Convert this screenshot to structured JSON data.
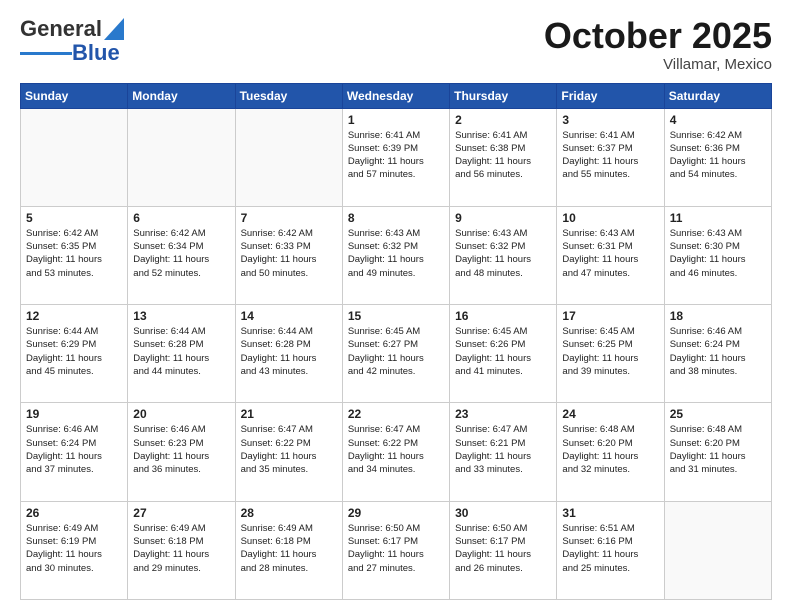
{
  "header": {
    "logo_general": "General",
    "logo_blue": "Blue",
    "month_title": "October 2025",
    "subtitle": "Villamar, Mexico"
  },
  "weekdays": [
    "Sunday",
    "Monday",
    "Tuesday",
    "Wednesday",
    "Thursday",
    "Friday",
    "Saturday"
  ],
  "weeks": [
    [
      {
        "day": "",
        "info": ""
      },
      {
        "day": "",
        "info": ""
      },
      {
        "day": "",
        "info": ""
      },
      {
        "day": "1",
        "info": "Sunrise: 6:41 AM\nSunset: 6:39 PM\nDaylight: 11 hours\nand 57 minutes."
      },
      {
        "day": "2",
        "info": "Sunrise: 6:41 AM\nSunset: 6:38 PM\nDaylight: 11 hours\nand 56 minutes."
      },
      {
        "day": "3",
        "info": "Sunrise: 6:41 AM\nSunset: 6:37 PM\nDaylight: 11 hours\nand 55 minutes."
      },
      {
        "day": "4",
        "info": "Sunrise: 6:42 AM\nSunset: 6:36 PM\nDaylight: 11 hours\nand 54 minutes."
      }
    ],
    [
      {
        "day": "5",
        "info": "Sunrise: 6:42 AM\nSunset: 6:35 PM\nDaylight: 11 hours\nand 53 minutes."
      },
      {
        "day": "6",
        "info": "Sunrise: 6:42 AM\nSunset: 6:34 PM\nDaylight: 11 hours\nand 52 minutes."
      },
      {
        "day": "7",
        "info": "Sunrise: 6:42 AM\nSunset: 6:33 PM\nDaylight: 11 hours\nand 50 minutes."
      },
      {
        "day": "8",
        "info": "Sunrise: 6:43 AM\nSunset: 6:32 PM\nDaylight: 11 hours\nand 49 minutes."
      },
      {
        "day": "9",
        "info": "Sunrise: 6:43 AM\nSunset: 6:32 PM\nDaylight: 11 hours\nand 48 minutes."
      },
      {
        "day": "10",
        "info": "Sunrise: 6:43 AM\nSunset: 6:31 PM\nDaylight: 11 hours\nand 47 minutes."
      },
      {
        "day": "11",
        "info": "Sunrise: 6:43 AM\nSunset: 6:30 PM\nDaylight: 11 hours\nand 46 minutes."
      }
    ],
    [
      {
        "day": "12",
        "info": "Sunrise: 6:44 AM\nSunset: 6:29 PM\nDaylight: 11 hours\nand 45 minutes."
      },
      {
        "day": "13",
        "info": "Sunrise: 6:44 AM\nSunset: 6:28 PM\nDaylight: 11 hours\nand 44 minutes."
      },
      {
        "day": "14",
        "info": "Sunrise: 6:44 AM\nSunset: 6:28 PM\nDaylight: 11 hours\nand 43 minutes."
      },
      {
        "day": "15",
        "info": "Sunrise: 6:45 AM\nSunset: 6:27 PM\nDaylight: 11 hours\nand 42 minutes."
      },
      {
        "day": "16",
        "info": "Sunrise: 6:45 AM\nSunset: 6:26 PM\nDaylight: 11 hours\nand 41 minutes."
      },
      {
        "day": "17",
        "info": "Sunrise: 6:45 AM\nSunset: 6:25 PM\nDaylight: 11 hours\nand 39 minutes."
      },
      {
        "day": "18",
        "info": "Sunrise: 6:46 AM\nSunset: 6:24 PM\nDaylight: 11 hours\nand 38 minutes."
      }
    ],
    [
      {
        "day": "19",
        "info": "Sunrise: 6:46 AM\nSunset: 6:24 PM\nDaylight: 11 hours\nand 37 minutes."
      },
      {
        "day": "20",
        "info": "Sunrise: 6:46 AM\nSunset: 6:23 PM\nDaylight: 11 hours\nand 36 minutes."
      },
      {
        "day": "21",
        "info": "Sunrise: 6:47 AM\nSunset: 6:22 PM\nDaylight: 11 hours\nand 35 minutes."
      },
      {
        "day": "22",
        "info": "Sunrise: 6:47 AM\nSunset: 6:22 PM\nDaylight: 11 hours\nand 34 minutes."
      },
      {
        "day": "23",
        "info": "Sunrise: 6:47 AM\nSunset: 6:21 PM\nDaylight: 11 hours\nand 33 minutes."
      },
      {
        "day": "24",
        "info": "Sunrise: 6:48 AM\nSunset: 6:20 PM\nDaylight: 11 hours\nand 32 minutes."
      },
      {
        "day": "25",
        "info": "Sunrise: 6:48 AM\nSunset: 6:20 PM\nDaylight: 11 hours\nand 31 minutes."
      }
    ],
    [
      {
        "day": "26",
        "info": "Sunrise: 6:49 AM\nSunset: 6:19 PM\nDaylight: 11 hours\nand 30 minutes."
      },
      {
        "day": "27",
        "info": "Sunrise: 6:49 AM\nSunset: 6:18 PM\nDaylight: 11 hours\nand 29 minutes."
      },
      {
        "day": "28",
        "info": "Sunrise: 6:49 AM\nSunset: 6:18 PM\nDaylight: 11 hours\nand 28 minutes."
      },
      {
        "day": "29",
        "info": "Sunrise: 6:50 AM\nSunset: 6:17 PM\nDaylight: 11 hours\nand 27 minutes."
      },
      {
        "day": "30",
        "info": "Sunrise: 6:50 AM\nSunset: 6:17 PM\nDaylight: 11 hours\nand 26 minutes."
      },
      {
        "day": "31",
        "info": "Sunrise: 6:51 AM\nSunset: 6:16 PM\nDaylight: 11 hours\nand 25 minutes."
      },
      {
        "day": "",
        "info": ""
      }
    ]
  ]
}
